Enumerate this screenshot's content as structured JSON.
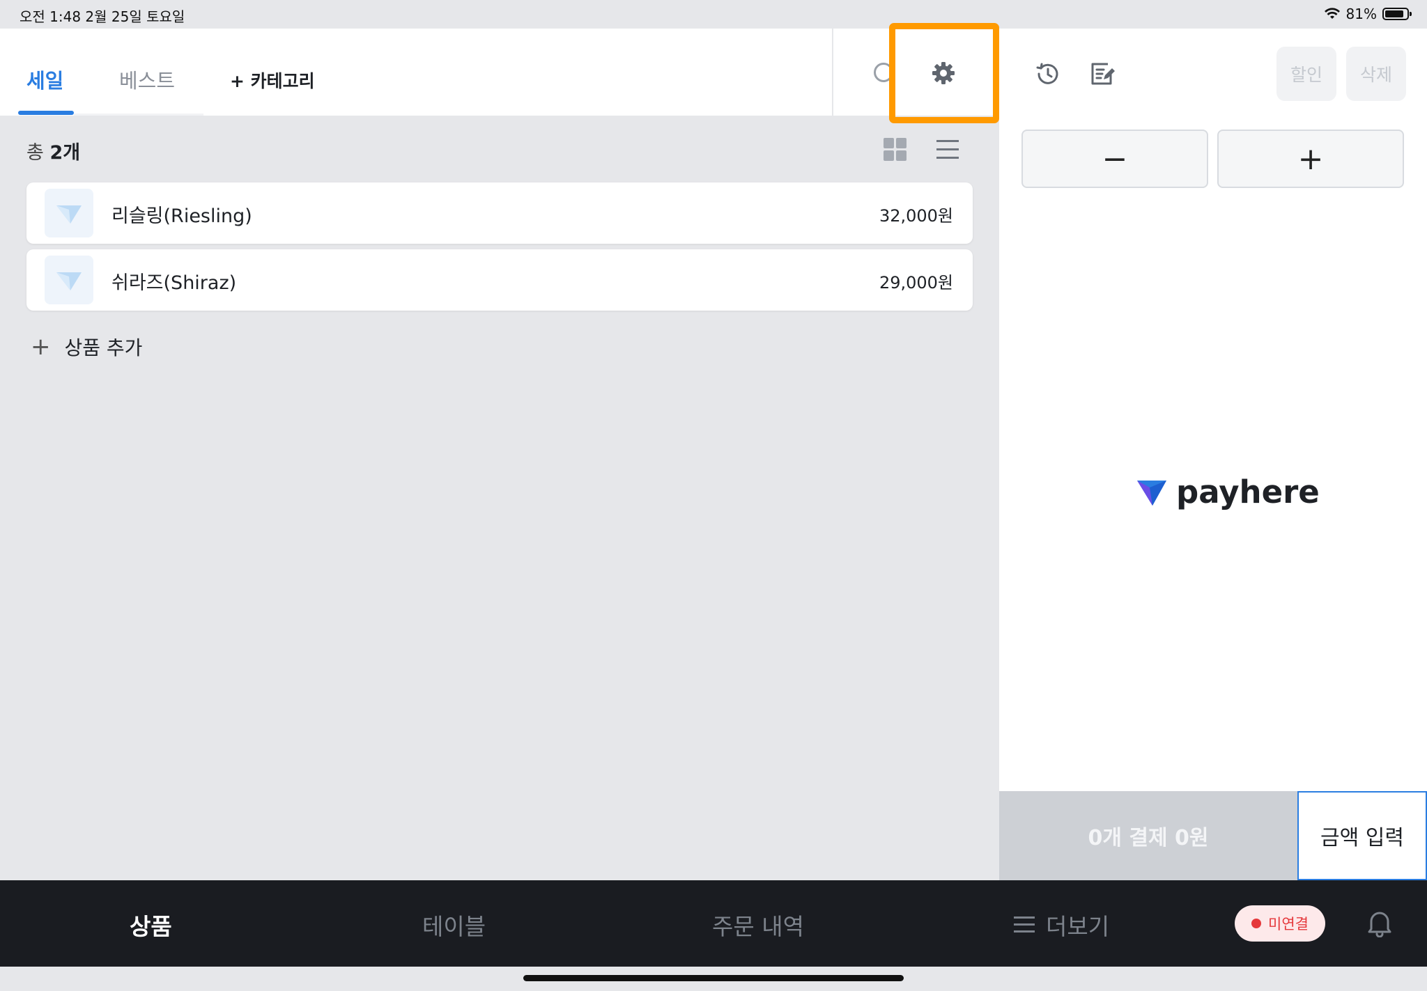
{
  "status_bar": {
    "time_date": "오전 1:48   2월 25일 토요일",
    "battery": "81%"
  },
  "tabs": {
    "sale": "세일",
    "best": "베스트",
    "add_category": "+ 카테고리"
  },
  "list": {
    "count_prefix": "총 ",
    "count_value": "2개"
  },
  "products": [
    {
      "name": "리슬링(Riesling)",
      "price": "32,000원"
    },
    {
      "name": "쉬라즈(Shiraz)",
      "price": "29,000원"
    }
  ],
  "add_product_label": "상품 추가",
  "right_panel": {
    "discount": "할인",
    "delete": "삭제",
    "minus": "−",
    "plus": "+",
    "logo_text": "payhere",
    "pay_button": "0개 결제 0원",
    "amount_input": "금액 입력"
  },
  "bottom_nav": {
    "products": "상품",
    "tables": "테이블",
    "orders": "주문 내역",
    "more": "더보기",
    "connection_status": "미연결"
  },
  "colors": {
    "accent": "#2a7de1",
    "highlight": "#ff9a00",
    "nav_bg": "#1a1c21",
    "status_red": "#e5383b"
  }
}
